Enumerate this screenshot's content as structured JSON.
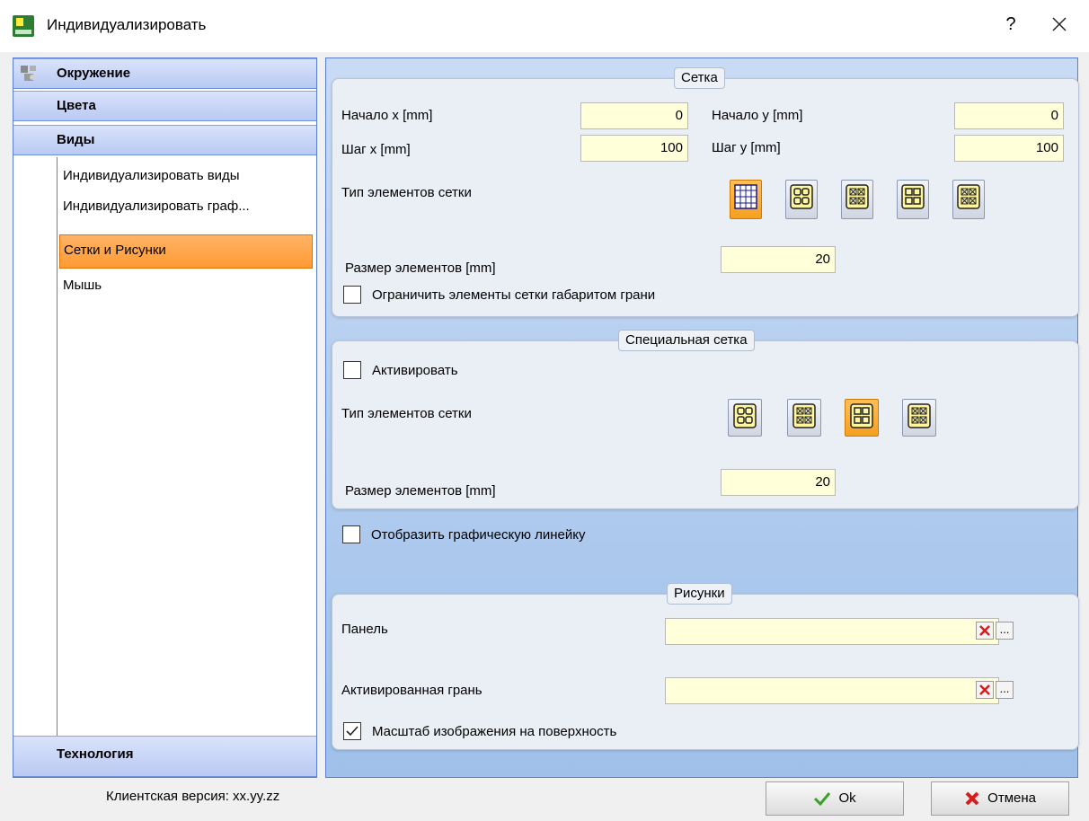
{
  "window": {
    "title": "Индивидуализировать",
    "help_label": "?"
  },
  "nav": {
    "sections": [
      {
        "label": "Окружение"
      },
      {
        "label": "Цвета"
      },
      {
        "label": "Виды"
      },
      {
        "label": "Технология"
      }
    ],
    "items": [
      {
        "label": "Индивидуализировать виды"
      },
      {
        "label": "Индивидуализировать граф..."
      },
      {
        "label": "Сетки и Рисунки",
        "selected": true
      },
      {
        "label": "Мышь"
      }
    ]
  },
  "grid": {
    "title": "Сетка",
    "start_x_label": "Начало x [mm]",
    "start_x_value": "0",
    "start_y_label": "Начало y [mm]",
    "start_y_value": "0",
    "step_x_label": "Шаг x [mm]",
    "step_x_value": "100",
    "step_y_label": "Шаг y [mm]",
    "step_y_value": "100",
    "element_type_label": "Тип элементов сетки",
    "element_types": [
      "grid-lines",
      "circles",
      "crosses",
      "squares",
      "crossed-squares"
    ],
    "selected_type_index": 0,
    "size_label": "Размер элементов [mm]",
    "size_value": "20",
    "limit_label": "Ограничить элементы сетки габаритом грани",
    "limit_checked": false
  },
  "special_grid": {
    "title": "Специальная сетка",
    "activate_label": "Активировать",
    "activate_checked": false,
    "element_type_label": "Тип элементов сетки",
    "element_types": [
      "circles",
      "crosses",
      "squares",
      "crossed-squares"
    ],
    "selected_type_index": 2,
    "size_label": "Размер элементов [mm]",
    "size_value": "20"
  },
  "ruler": {
    "label": "Отобразить графическую линейку",
    "checked": false
  },
  "pictures": {
    "title": "Рисунки",
    "panel_label": "Панель",
    "panel_value": "",
    "face_label": "Активированная грань",
    "face_value": "",
    "scale_label": "Масштаб изображения на поверхность",
    "scale_checked": true,
    "clear_icon": "x-icon",
    "browse_label": "..."
  },
  "footer": {
    "version_text": "Клиентская версия: xx.yy.zz",
    "ok_label": "Ok",
    "cancel_label": "Отмена"
  },
  "colors": {
    "panel_bg": "#9fc0ea",
    "selected": "#ff9a33",
    "field_bg": "#ffffd9",
    "nav_border": "#5b7fd0"
  }
}
